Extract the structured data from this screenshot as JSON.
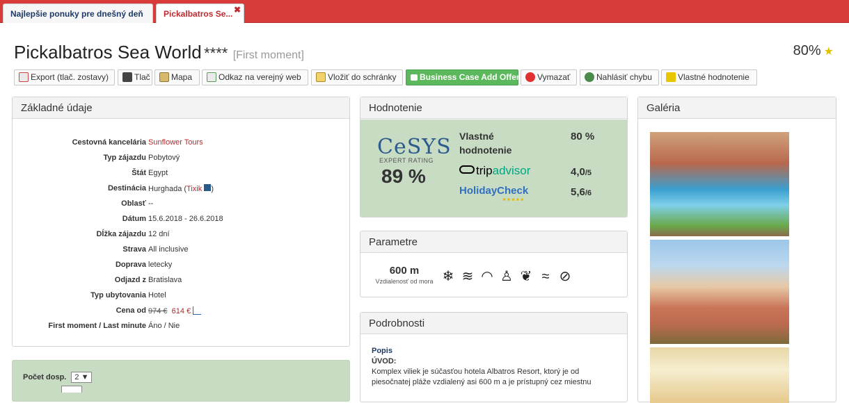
{
  "tabs": [
    {
      "label": "Najlepšie ponuky pre dnešný deň"
    },
    {
      "label": "Pickalbatros Se...",
      "close": "✖"
    }
  ],
  "header": {
    "title": "Pickalbatros Sea World",
    "stars": "****",
    "moment": "[First moment]",
    "score": "80%"
  },
  "toolbar": {
    "export": "Export (tlač. zostavy)",
    "print": "Tlač",
    "map": "Mapa",
    "link": "Odkaz na verejný web",
    "clipboard": "Vložiť do schránky",
    "business": "Business Case Add Offer",
    "delete": "Vymazať",
    "report": "Nahlásiť chybu",
    "own_rating": "Vlastné hodnotenie"
  },
  "basic": {
    "title": "Základné údaje",
    "rows": [
      {
        "k": "Cestovná kancelária",
        "v": "Sunflower Tours"
      },
      {
        "k": "Typ zájazdu",
        "v": "Pobytový"
      },
      {
        "k": "Štát",
        "v": "Egypt"
      },
      {
        "k": "Destinácia",
        "v": "Hurghada (",
        "link": "Tixik",
        "tail": ")"
      },
      {
        "k": "Oblasť",
        "v": "--"
      },
      {
        "k": "Dátum",
        "v": "15.6.2018 - 26.6.2018"
      },
      {
        "k": "Dĺžka zájazdu",
        "v": "12 dní"
      },
      {
        "k": "Strava",
        "v": "All inclusive"
      },
      {
        "k": "Doprava",
        "v": "letecky"
      },
      {
        "k": "Odjazd z",
        "v": "Bratislava"
      },
      {
        "k": "Typ ubytovania",
        "v": "Hotel"
      },
      {
        "k": "Cena od",
        "old": "974 €",
        "new": "614 €"
      },
      {
        "k": "First moment / Last minute",
        "v": "Áno / Nie"
      }
    ]
  },
  "rating": {
    "title": "Hodnotenie",
    "cesys_logo": "CeSYS",
    "cesys_sub": "EXPERT RATING",
    "cesys_value": "89 %",
    "own_label_1": "Vlastné",
    "own_label_2": "hodnotenie",
    "own_value": "80 %",
    "trip_a": "trip",
    "trip_b": "advisor",
    "trip_value": "4,0",
    "trip_max": "/5",
    "hc_logo": "HolidayCheck",
    "hc_value": "5,6",
    "hc_max": "/6"
  },
  "params": {
    "title": "Parametre",
    "distance": "600 m",
    "distance_label": "Vzdialenosť od mora",
    "icons": [
      "air-conditioning-icon",
      "pool-icon",
      "wifi-icon",
      "family-icon",
      "spa-icon",
      "beach-icon",
      "tennis-icon"
    ]
  },
  "details": {
    "title": "Podrobnosti",
    "section": "Popis",
    "heading": "ÚVOD:",
    "text": "Komplex viliek je súčasťou hotela Albatros Resort, ktorý je od piesočnatej pláže vzdialený asi 600 m a je prístupný cez miestnu"
  },
  "gallery": {
    "title": "Galéria"
  },
  "booking": {
    "persons_label": "Počet dosp.",
    "persons_value": "2 ▼"
  },
  "colors": {
    "accent_red": "#d93a3a",
    "panel_green": "#c8dcc4",
    "button_green": "#5cb85c",
    "link_red": "#b4282e"
  }
}
